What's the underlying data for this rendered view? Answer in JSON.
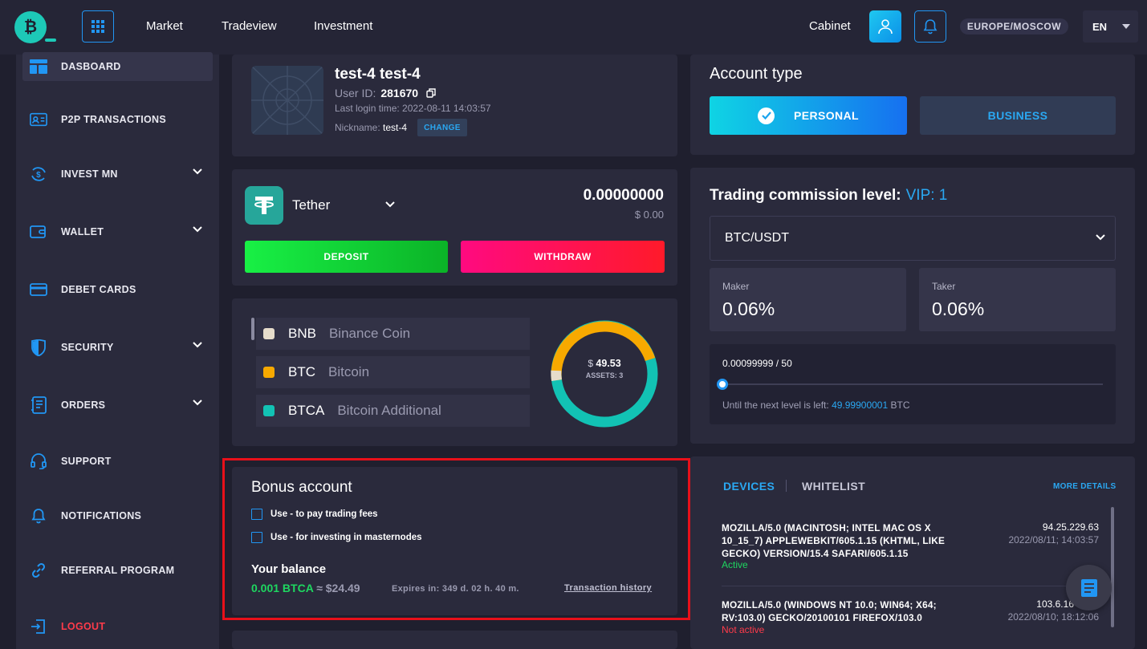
{
  "header": {
    "nav": [
      "Market",
      "Tradeview",
      "Investment"
    ],
    "cabinet": "Cabinet",
    "timezone": "EUROPE/MOSCOW",
    "language": "EN",
    "logo_letter": "₿"
  },
  "sidebar": {
    "items": [
      {
        "label": "DASBOARD",
        "icon": "dashboard-icon"
      },
      {
        "label": "P2P TRANSACTIONS",
        "icon": "id-card-icon"
      },
      {
        "label": "INVEST MN",
        "icon": "invest-icon"
      },
      {
        "label": "WALLET",
        "icon": "wallet-icon"
      },
      {
        "label": "DEBET CARDS",
        "icon": "card-icon"
      },
      {
        "label": "SECURITY",
        "icon": "shield-icon"
      },
      {
        "label": "ORDERS",
        "icon": "orders-icon"
      },
      {
        "label": "SUPPORT",
        "icon": "headset-icon"
      },
      {
        "label": "NOTIFICATIONS",
        "icon": "bell-icon"
      },
      {
        "label": "REFERRAL PROGRAM",
        "icon": "link-icon"
      },
      {
        "label": "LOGOUT",
        "icon": "logout-icon"
      }
    ]
  },
  "profile": {
    "name": "test-4 test-4",
    "user_id_label": "User ID:",
    "user_id": "281670",
    "last_login": "Last login time: 2022-08-11 14:03:57",
    "nickname_label": "Nickname:",
    "nickname": "test-4",
    "change_label": "CHANGE"
  },
  "account_type": {
    "title": "Account type",
    "personal": "PERSONAL",
    "business": "BUSINESS"
  },
  "wallet": {
    "currency": "Tether",
    "balance": "0.00000000",
    "balance_usd": "$ 0.00",
    "deposit": "DEPOSIT",
    "withdraw": "WITHDRAW"
  },
  "assets": {
    "items": [
      {
        "symbol": "BNB",
        "name": "Binance Coin",
        "color": "#e6dccb"
      },
      {
        "symbol": "BTC",
        "name": "Bitcoin",
        "color": "#f7a900"
      },
      {
        "symbol": "BTCA",
        "name": "Bitcoin Additional",
        "color": "#12c2b4"
      }
    ],
    "total_prefix": "$",
    "total": "49.53",
    "count_label": "ASSETS: 3"
  },
  "trading": {
    "title": "Trading commission level:",
    "vip": "VIP: 1",
    "pair": "BTC/USDT",
    "maker_label": "Maker",
    "maker": "0.06%",
    "taker_label": "Taker",
    "taker": "0.06%",
    "progress_text": "0.00099999 / 50",
    "progress_value": 0.00099999,
    "progress_max": 50,
    "next_level_prefix": "Until the next level is left:",
    "next_level_amount": "49.99900001",
    "next_level_unit": "BTC"
  },
  "bonus": {
    "title": "Bonus account",
    "option1": "Use - to pay trading fees",
    "option2": "Use - for investing in masternodes",
    "your_balance": "Your balance",
    "amount": "0.001 BTCA",
    "approx": "≈ $24.49",
    "expires": "Expires in:  349 d. 02 h. 40 m.",
    "history": "Transaction history"
  },
  "devices": {
    "tab_devices": "DEVICES",
    "tab_whitelist": "WHITELIST",
    "more": "MORE DETAILS",
    "rows": [
      {
        "ua": "MOZILLA/5.0 (MACINTOSH; INTEL MAC OS X 10_15_7) APPLEWEBKIT/605.1.15 (KHTML, LIKE GECKO) VERSION/15.4 SAFARI/605.1.15",
        "ip": "94.25.229.63",
        "date": "2022/08/11; 14:03:57",
        "status": "Active"
      },
      {
        "ua": "MOZILLA/5.0 (WINDOWS NT 10.0; WIN64; X64; RV:103.0) GECKO/20100101 FIREFOX/103.0",
        "ip": "103.6.16",
        "date": "2022/08/10; 18:12:06",
        "status": "Not active"
      }
    ]
  }
}
